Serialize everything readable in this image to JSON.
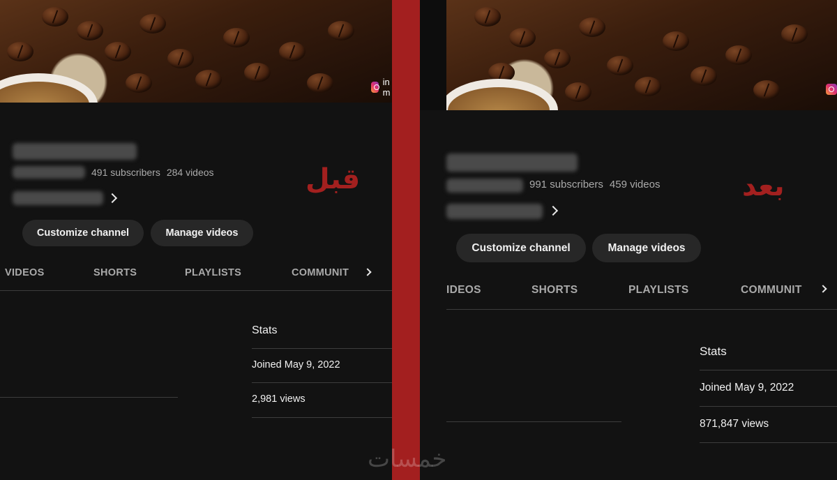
{
  "colors": {
    "divider": "#a31f1f",
    "label": "#a3201f",
    "background": "#121212",
    "button": "#272727"
  },
  "before": {
    "label": "قبل",
    "banner": {
      "instagram_text": "in      m",
      "icon": "instagram-icon"
    },
    "subscribers": "491 subscribers",
    "videos": "284 videos",
    "buttons": {
      "customize": "Customize channel",
      "manage": "Manage videos"
    },
    "tabs": [
      "VIDEOS",
      "SHORTS",
      "PLAYLISTS",
      "COMMUNIT"
    ],
    "stats": {
      "title": "Stats",
      "joined": "Joined May 9, 2022",
      "views": "2,981 views"
    }
  },
  "after": {
    "label": "بعد",
    "subscribers": "991 subscribers",
    "videos": "459 videos",
    "buttons": {
      "customize": "Customize channel",
      "manage": "Manage videos"
    },
    "tabs": [
      "IDEOS",
      "SHORTS",
      "PLAYLISTS",
      "COMMUNIT"
    ],
    "stats": {
      "title": "Stats",
      "joined": "Joined May 9, 2022",
      "views": "871,847 views"
    }
  },
  "watermark": "خمسات"
}
